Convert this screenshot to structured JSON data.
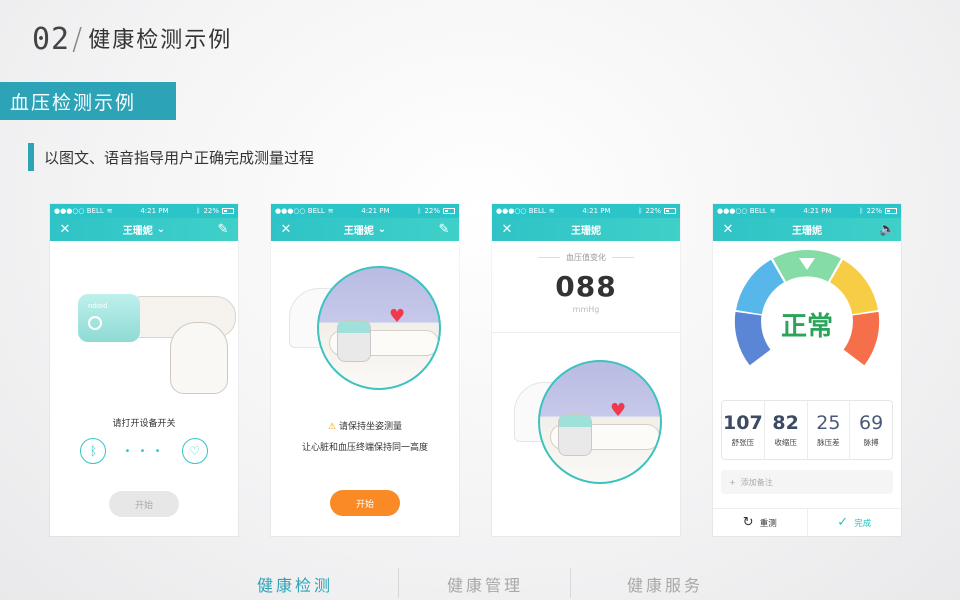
{
  "section": {
    "number": "02",
    "slash": "/",
    "title": "健康检测示例"
  },
  "banner": "血压检测示例",
  "subtitle": "以图文、语音指导用户正确完成测量过程",
  "status_bar": {
    "carrier": "●●●○○ BELL",
    "time": "4:21 PM",
    "battery": "22%"
  },
  "colors": {
    "accent": "#2da3b8",
    "nav": "#2bc4c9",
    "orange": "#f98a26",
    "normal_green": "#2aa45a"
  },
  "phone1": {
    "nav_title": "王珊妮",
    "device_brand": "ndoid",
    "instruction": "请打开设备开关",
    "button": "开始"
  },
  "phone2": {
    "nav_title": "王珊妮",
    "warning": "请保持坐姿测量",
    "note": "让心脏和血压终端保持同一高度",
    "button": "开始"
  },
  "phone3": {
    "nav_title": "王珊妮",
    "caption": "血压值变化",
    "value": "088",
    "unit": "mmHg"
  },
  "phone4": {
    "nav_title": "王珊妮",
    "result": "正常",
    "stats": [
      {
        "value": "107",
        "label": "舒张压"
      },
      {
        "value": "82",
        "label": "收缩压"
      },
      {
        "value": "25",
        "label": "脉压差"
      },
      {
        "value": "69",
        "label": "脉搏"
      }
    ],
    "note_placeholder": "添加备注",
    "retest": "重测",
    "done": "完成"
  },
  "tabs": [
    "健康检测",
    "健康管理",
    "健康服务"
  ]
}
